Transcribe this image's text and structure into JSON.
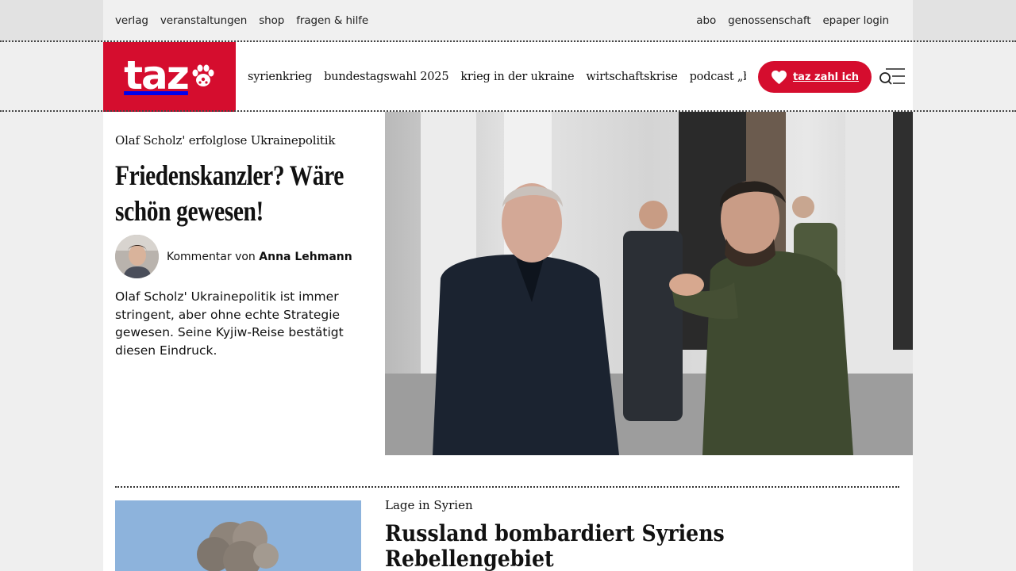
{
  "utility_nav": {
    "left": [
      "verlag",
      "veranstaltungen",
      "shop",
      "fragen & hilfe"
    ],
    "right": [
      "abo",
      "genossenschaft",
      "epaper login"
    ]
  },
  "logo": {
    "text": "taz"
  },
  "main_nav": [
    "syrienkrieg",
    "bundestagswahl 2025",
    "krieg in der ukraine",
    "wirtschaftskrise",
    "podcast „bundestalk“"
  ],
  "support_button": {
    "label": "taz zahl ich"
  },
  "colors": {
    "brand_red": "#d50d2e",
    "text": "#111111",
    "background": "#efefef"
  },
  "lead_article": {
    "kicker": "Olaf Scholz' erfolglose Ukrainepolitik",
    "headline": "Friedenskanzler? Wäre schön gewesen!",
    "byline_prefix": "Kommentar von",
    "author": "Anna Lehmann",
    "teaser": "Olaf Scholz' Ukrainepolitik ist immer stringent, aber ohne echte Strategie gewesen. Seine Kyjiw-Reise bestätigt diesen Eindruck."
  },
  "second_article": {
    "kicker": "Lage in Syrien",
    "headline": "Russland bombardiert Syriens Rebellengebiet"
  }
}
